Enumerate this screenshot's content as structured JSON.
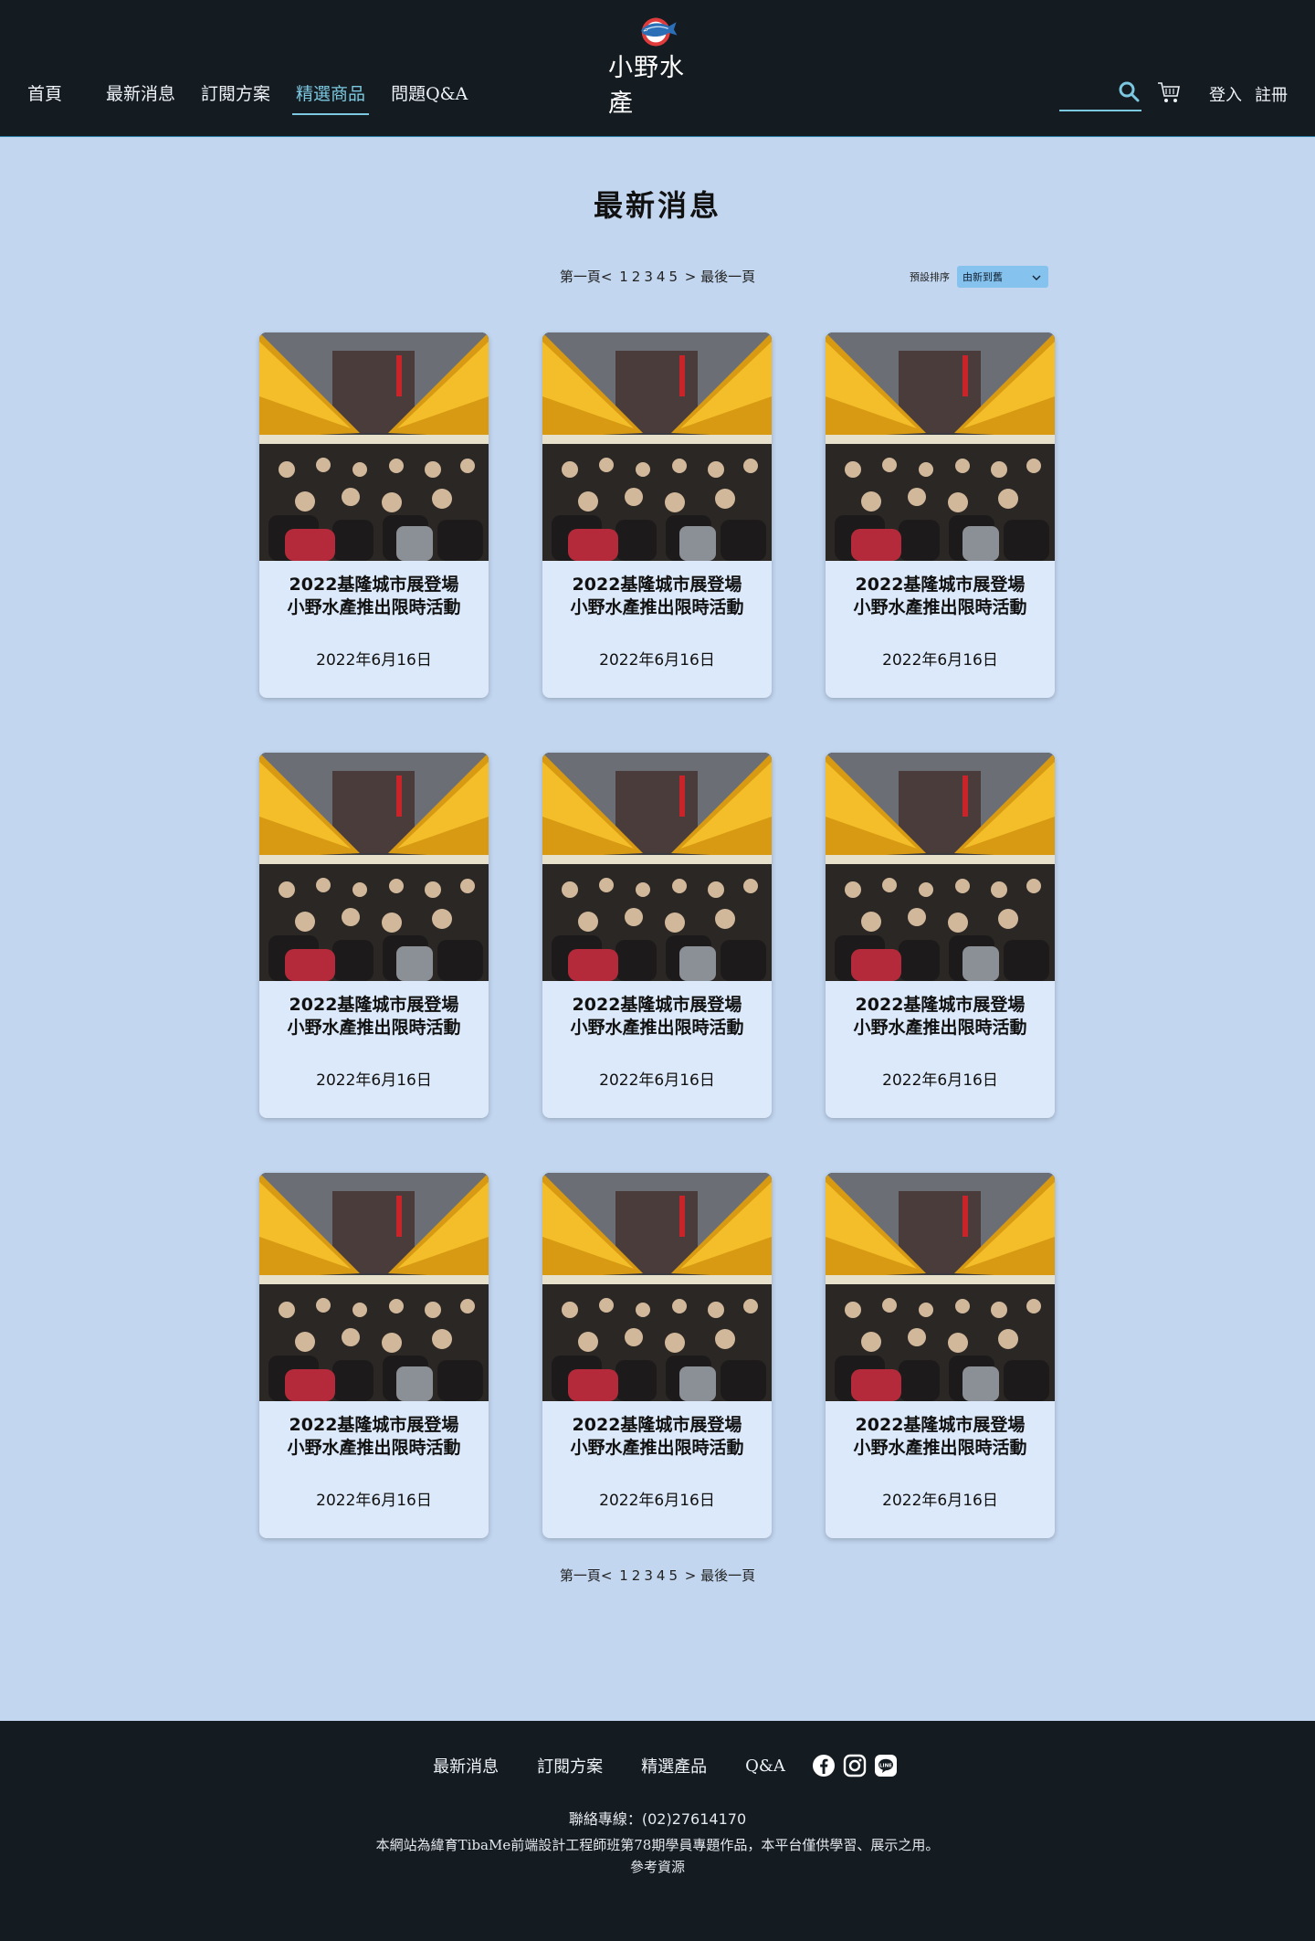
{
  "header": {
    "nav": [
      {
        "label": "首頁",
        "active": false
      },
      {
        "label": "最新消息",
        "active": false
      },
      {
        "label": "訂閱方案",
        "active": false
      },
      {
        "label": "精選商品",
        "active": true
      },
      {
        "label": "問題Q&A",
        "active": false
      }
    ],
    "brand": "小野水產",
    "search": {
      "placeholder": "",
      "value": ""
    },
    "login_label": "登入",
    "register_label": "註冊"
  },
  "main": {
    "title": "最新消息",
    "pagination": {
      "first_label": "第一頁<",
      "pages": [
        "1",
        "2",
        "3",
        "4",
        "5"
      ],
      "last_label": "> 最後一頁"
    },
    "sort": {
      "label": "預設排序",
      "selected": "由新到舊"
    },
    "cards": [
      {
        "title_line1": "2022基隆城市展登場",
        "title_line2": "小野水產推出限時活動",
        "date": "2022年6月16日"
      },
      {
        "title_line1": "2022基隆城市展登場",
        "title_line2": "小野水產推出限時活動",
        "date": "2022年6月16日"
      },
      {
        "title_line1": "2022基隆城市展登場",
        "title_line2": "小野水產推出限時活動",
        "date": "2022年6月16日"
      },
      {
        "title_line1": "2022基隆城市展登場",
        "title_line2": "小野水產推出限時活動",
        "date": "2022年6月16日"
      },
      {
        "title_line1": "2022基隆城市展登場",
        "title_line2": "小野水產推出限時活動",
        "date": "2022年6月16日"
      },
      {
        "title_line1": "2022基隆城市展登場",
        "title_line2": "小野水產推出限時活動",
        "date": "2022年6月16日"
      },
      {
        "title_line1": "2022基隆城市展登場",
        "title_line2": "小野水產推出限時活動",
        "date": "2022年6月16日"
      },
      {
        "title_line1": "2022基隆城市展登場",
        "title_line2": "小野水產推出限時活動",
        "date": "2022年6月16日"
      },
      {
        "title_line1": "2022基隆城市展登場",
        "title_line2": "小野水產推出限時活動",
        "date": "2022年6月16日"
      }
    ]
  },
  "footer": {
    "nav": [
      "最新消息",
      "訂閱方案",
      "精選產品",
      "Q&A"
    ],
    "social": [
      "facebook-icon",
      "instagram-icon",
      "line-icon"
    ],
    "phone": "聯絡專線：(02)27614170",
    "note": "本網站為緯育TibaMe前端設計工程師班第78期學員專題作品，本平台僅供學習、展示之用。",
    "reference": "參考資源"
  },
  "colors": {
    "header_bg": "#141b21",
    "page_bg": "#c2d6f0",
    "card_bg": "#dce9fa",
    "accent": "#7cc8e0",
    "sort_bg": "#86c2ee"
  }
}
